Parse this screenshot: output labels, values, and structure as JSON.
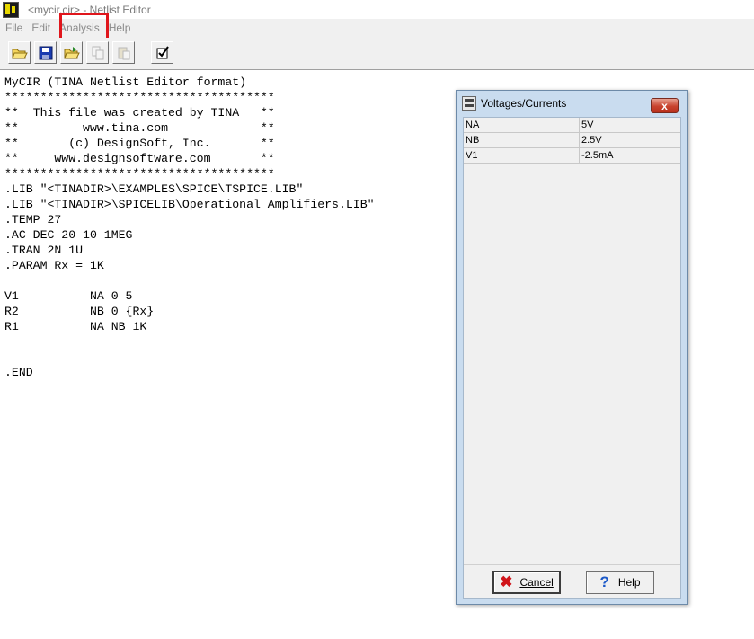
{
  "window": {
    "title": "<mycir.cir> - Netlist Editor"
  },
  "menu": {
    "items": [
      "File",
      "Edit",
      "Analysis",
      "Help"
    ]
  },
  "toolbar": {
    "buttons": [
      {
        "icon": "open-folder-icon",
        "glyph": "📂"
      },
      {
        "icon": "save-icon",
        "glyph": "💾"
      },
      {
        "icon": "open-file-icon",
        "glyph": "📂"
      },
      {
        "icon": "copy-icon",
        "glyph": "⎘"
      },
      {
        "icon": "paste-icon",
        "glyph": "📋"
      },
      {
        "icon": "check-icon",
        "glyph": "☑"
      }
    ]
  },
  "editor": {
    "lines": [
      "MyCIR (TINA Netlist Editor format)",
      "**************************************",
      "**  This file was created by TINA   **",
      "**         www.tina.com             **",
      "**       (c) DesignSoft, Inc.       **",
      "**     www.designsoftware.com       **",
      "**************************************",
      ".LIB \"<TINADIR>\\EXAMPLES\\SPICE\\TSPICE.LIB\"",
      ".LIB \"<TINADIR>\\SPICELIB\\Operational Amplifiers.LIB\"",
      ".TEMP 27",
      ".AC DEC 20 10 1MEG",
      ".TRAN 2N 1U",
      ".PARAM Rx = 1K",
      "",
      "V1          NA 0 5",
      "R2          NB 0 {Rx}",
      "R1          NA NB 1K",
      "",
      "",
      ".END"
    ]
  },
  "dialog": {
    "title": "Voltages/Currents",
    "close_glyph": "x",
    "rows": [
      {
        "name": "NA",
        "value": "5V"
      },
      {
        "name": "NB",
        "value": "2.5V"
      },
      {
        "name": "V1",
        "value": "-2.5mA"
      }
    ],
    "cancel_label": "Cancel",
    "help_label": "Help",
    "cancel_glyph": "✖",
    "help_glyph": "?"
  }
}
